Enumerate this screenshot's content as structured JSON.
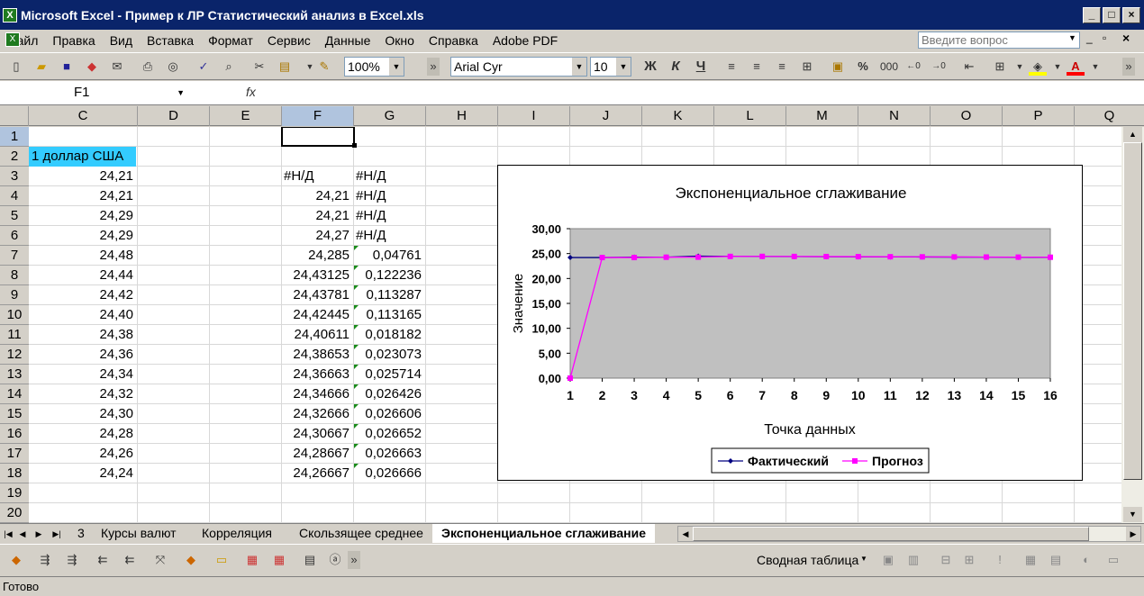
{
  "window": {
    "title": "Microsoft Excel - Пример к ЛР Статистический анализ в Excel.xls"
  },
  "menu": [
    "Файл",
    "Правка",
    "Вид",
    "Вставка",
    "Формат",
    "Сервис",
    "Данные",
    "Окно",
    "Справка",
    "Adobe PDF"
  ],
  "help_placeholder": "Введите вопрос",
  "toolbar": {
    "zoom": "100%",
    "font": "Arial Cyr",
    "size": "10",
    "bold": "Ж",
    "italic": "К",
    "underline": "Ч",
    "percent": "%",
    "thousands": "000"
  },
  "name_box": "F1",
  "fx_label": "fx",
  "columns": [
    "C",
    "D",
    "E",
    "F",
    "G",
    "H",
    "I",
    "J",
    "K",
    "L",
    "M",
    "N",
    "O",
    "P",
    "Q"
  ],
  "rows": [
    "1",
    "2",
    "3",
    "4",
    "5",
    "6",
    "7",
    "8",
    "9",
    "10",
    "11",
    "12",
    "13",
    "14",
    "15",
    "16",
    "17",
    "18",
    "19",
    "20"
  ],
  "cells": {
    "c2": "1 доллар США",
    "c": [
      "24,21",
      "24,21",
      "24,29",
      "24,29",
      "24,48",
      "24,44",
      "24,42",
      "24,40",
      "24,38",
      "24,36",
      "24,34",
      "24,32",
      "24,30",
      "24,28",
      "24,26",
      "24,24"
    ],
    "f": [
      "#Н/Д",
      "24,21",
      "24,21",
      "24,27",
      "24,285",
      "24,43125",
      "24,43781",
      "24,42445",
      "24,40611",
      "24,38653",
      "24,36663",
      "24,34666",
      "24,32666",
      "24,30667",
      "24,28667",
      "24,26667"
    ],
    "g": [
      "#Н/Д",
      "#Н/Д",
      "#Н/Д",
      "#Н/Д",
      "0,04761",
      "0,122236",
      "0,113287",
      "0,113165",
      "0,018182",
      "0,023073",
      "0,025714",
      "0,026426",
      "0,026606",
      "0,026652",
      "0,026663",
      "0,026666"
    ]
  },
  "chart_data": {
    "type": "line",
    "title": "Экспоненциальное сглаживание",
    "xlabel": "Точка данных",
    "ylabel": "Значение",
    "x": [
      1,
      2,
      3,
      4,
      5,
      6,
      7,
      8,
      9,
      10,
      11,
      12,
      13,
      14,
      15,
      16
    ],
    "ylim": [
      0,
      30
    ],
    "yticks": [
      "0,00",
      "5,00",
      "10,00",
      "15,00",
      "20,00",
      "25,00",
      "30,00"
    ],
    "legend_position": "bottom",
    "series": [
      {
        "name": "Фактический",
        "color": "#000080",
        "marker": "diamond",
        "values": [
          24.21,
          24.21,
          24.29,
          24.29,
          24.48,
          24.44,
          24.42,
          24.4,
          24.38,
          24.36,
          24.34,
          24.32,
          24.3,
          24.28,
          24.26,
          24.24
        ]
      },
      {
        "name": "Прогноз",
        "color": "#ff00ff",
        "marker": "square",
        "values": [
          0,
          24.21,
          24.21,
          24.27,
          24.285,
          24.43125,
          24.43781,
          24.42445,
          24.40611,
          24.38653,
          24.36663,
          24.34666,
          24.32666,
          24.30667,
          24.28667,
          24.26667
        ]
      }
    ]
  },
  "tabs": [
    "3",
    "Курсы валют",
    "Корреляция",
    "Скользящее среднее",
    "Экспоненциальное сглаживание"
  ],
  "pivot_label": "Сводная таблица",
  "status": "Готово"
}
